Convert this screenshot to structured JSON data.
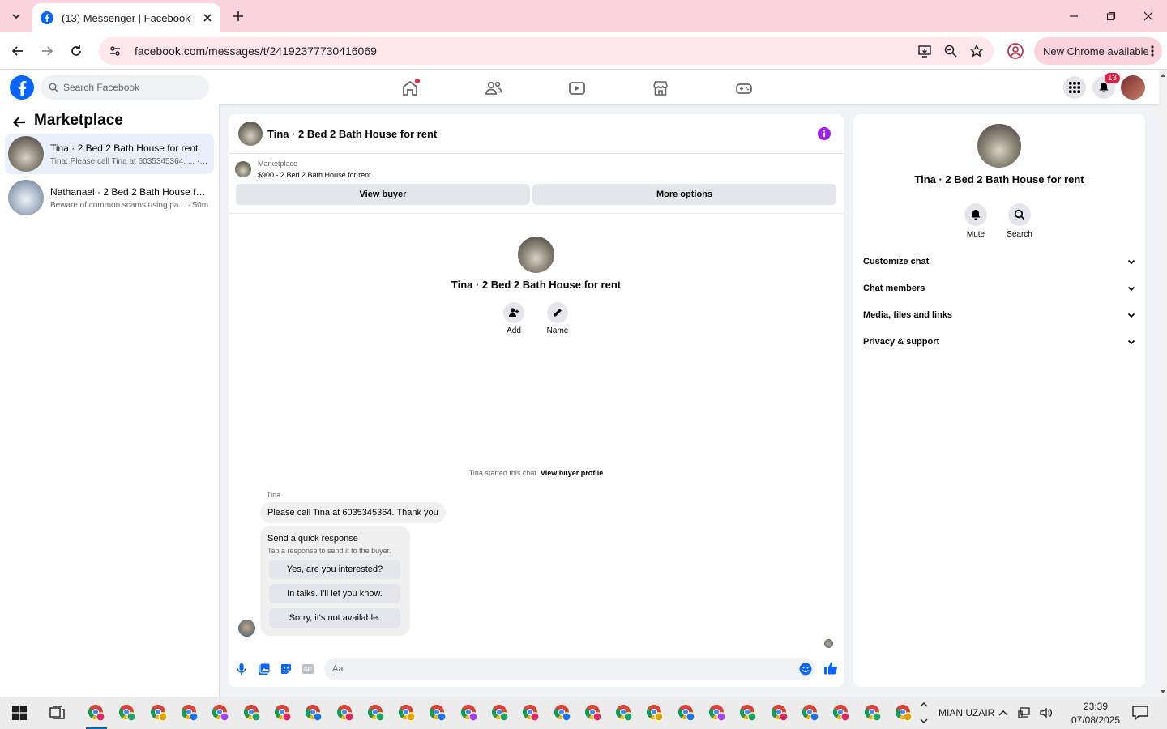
{
  "browser": {
    "tab_title": "(13) Messenger | Facebook",
    "url": "facebook.com/messages/t/24192377730416069",
    "new_chrome": "New Chrome available",
    "accent": "#fbd3dc"
  },
  "fbnav": {
    "search_placeholder": "Search Facebook",
    "notification_count": "13"
  },
  "sidebar": {
    "title": "Marketplace",
    "conversations": [
      {
        "name": "Tina · 2 Bed 2 Bath House for rent",
        "preview": "Tina: Please call Tina at 6035345364. ... · 1m",
        "active": true
      },
      {
        "name": "Nathanael · 2 Bed 2 Bath House fo...",
        "preview": "Beware of common scams using pa... · 50m",
        "active": false
      }
    ]
  },
  "chat": {
    "header_title": "Tina · 2 Bed 2 Bath House for rent",
    "marketplace_label": "Marketplace",
    "listing_title": "$900 - 2 Bed 2 Bath House for rent",
    "view_buyer": "View buyer",
    "more_options": "More options",
    "intro_name": "Tina · 2 Bed 2 Bath House for rent",
    "add_label": "Add",
    "name_label": "Name",
    "started_text": "Tina started this chat.",
    "view_buyer_profile": "View buyer profile",
    "sender": "Tina",
    "message": "Please call Tina at 6035345364. Thank you",
    "quick_title": "Send a quick response",
    "quick_sub": "Tap a response to send it to the buyer.",
    "quick_replies": [
      "Yes, are you interested?",
      "In talks. I'll let you know.",
      "Sorry, it's not available."
    ],
    "composer_placeholder": "Aa",
    "accent": "#0866ff"
  },
  "right_panel": {
    "name": "Tina · 2 Bed 2 Bath House for rent",
    "mute": "Mute",
    "search": "Search",
    "sections": [
      "Customize chat",
      "Chat members",
      "Media, files and links",
      "Privacy & support"
    ]
  },
  "taskbar": {
    "user": "MIAN UZAIR",
    "time": "23:39",
    "date": "07/08/2025"
  }
}
